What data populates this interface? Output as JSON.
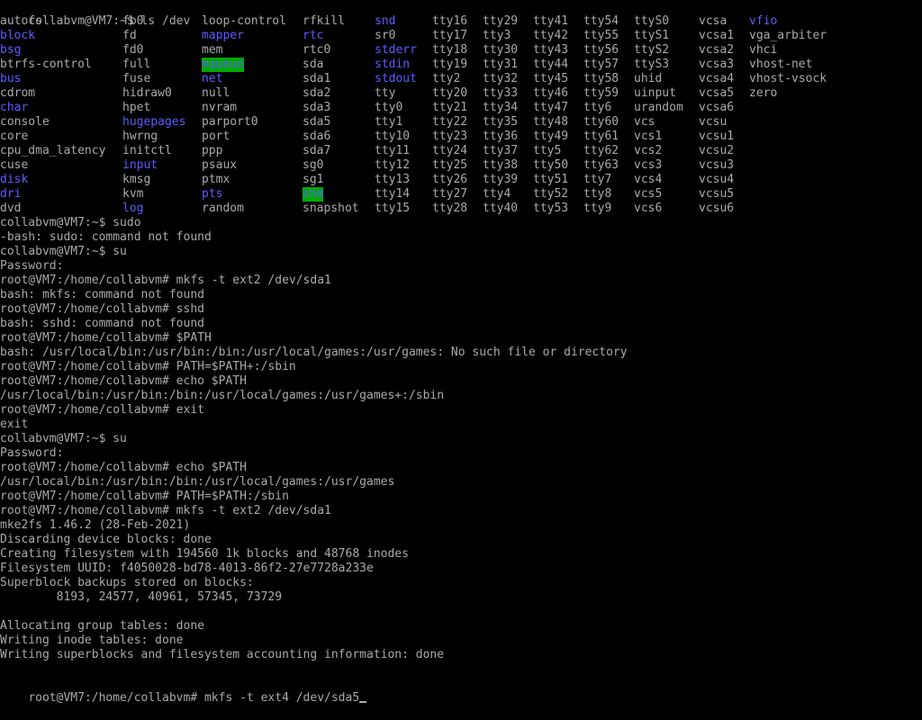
{
  "colors": {
    "background": "#000000",
    "foreground": "#aaaaaa",
    "directory": "#5c5cff",
    "highlight_bg": "#00aa00"
  },
  "first_prompt": "collabvm@VM7:~$ ls /dev",
  "ls_rows": [
    [
      {
        "t": "autofs"
      },
      {
        "t": "fb0"
      },
      {
        "t": "loop-control"
      },
      {
        "t": "rfkill"
      },
      {
        "t": "snd",
        "s": "dir"
      },
      {
        "t": "tty16"
      },
      {
        "t": "tty29"
      },
      {
        "t": "tty41"
      },
      {
        "t": "tty54"
      },
      {
        "t": "ttyS0"
      },
      {
        "t": "vcsa"
      },
      {
        "t": "vfio",
        "s": "dir"
      }
    ],
    [
      {
        "t": "block",
        "s": "dir"
      },
      {
        "t": "fd"
      },
      {
        "t": "mapper",
        "s": "dir"
      },
      {
        "t": "rtc",
        "s": "dir"
      },
      {
        "t": "sr0"
      },
      {
        "t": "tty17"
      },
      {
        "t": "tty3"
      },
      {
        "t": "tty42"
      },
      {
        "t": "tty55"
      },
      {
        "t": "ttyS1"
      },
      {
        "t": "vcsa1"
      },
      {
        "t": "vga_arbiter"
      }
    ],
    [
      {
        "t": "bsg",
        "s": "dir"
      },
      {
        "t": "fd0"
      },
      {
        "t": "mem"
      },
      {
        "t": "rtc0"
      },
      {
        "t": "stderr",
        "s": "dir"
      },
      {
        "t": "tty18"
      },
      {
        "t": "tty30"
      },
      {
        "t": "tty43"
      },
      {
        "t": "tty56"
      },
      {
        "t": "ttyS2"
      },
      {
        "t": "vcsa2"
      },
      {
        "t": "vhci"
      }
    ],
    [
      {
        "t": "btrfs-control"
      },
      {
        "t": "full"
      },
      {
        "t": "mqueue",
        "s": "hl"
      },
      {
        "t": "sda"
      },
      {
        "t": "stdin",
        "s": "dir"
      },
      {
        "t": "tty19"
      },
      {
        "t": "tty31"
      },
      {
        "t": "tty44"
      },
      {
        "t": "tty57"
      },
      {
        "t": "ttyS3"
      },
      {
        "t": "vcsa3"
      },
      {
        "t": "vhost-net"
      }
    ],
    [
      {
        "t": "bus",
        "s": "dir"
      },
      {
        "t": "fuse"
      },
      {
        "t": "net",
        "s": "dir"
      },
      {
        "t": "sda1"
      },
      {
        "t": "stdout",
        "s": "dir"
      },
      {
        "t": "tty2"
      },
      {
        "t": "tty32"
      },
      {
        "t": "tty45"
      },
      {
        "t": "tty58"
      },
      {
        "t": "uhid"
      },
      {
        "t": "vcsa4"
      },
      {
        "t": "vhost-vsock"
      }
    ],
    [
      {
        "t": "cdrom"
      },
      {
        "t": "hidraw0"
      },
      {
        "t": "null"
      },
      {
        "t": "sda2"
      },
      {
        "t": "tty"
      },
      {
        "t": "tty20"
      },
      {
        "t": "tty33"
      },
      {
        "t": "tty46"
      },
      {
        "t": "tty59"
      },
      {
        "t": "uinput"
      },
      {
        "t": "vcsa5"
      },
      {
        "t": "zero"
      }
    ],
    [
      {
        "t": "char",
        "s": "dir"
      },
      {
        "t": "hpet"
      },
      {
        "t": "nvram"
      },
      {
        "t": "sda3"
      },
      {
        "t": "tty0"
      },
      {
        "t": "tty21"
      },
      {
        "t": "tty34"
      },
      {
        "t": "tty47"
      },
      {
        "t": "tty6"
      },
      {
        "t": "urandom"
      },
      {
        "t": "vcsa6"
      },
      {
        "t": ""
      }
    ],
    [
      {
        "t": "console"
      },
      {
        "t": "hugepages",
        "s": "dir"
      },
      {
        "t": "parport0"
      },
      {
        "t": "sda5"
      },
      {
        "t": "tty1"
      },
      {
        "t": "tty22"
      },
      {
        "t": "tty35"
      },
      {
        "t": "tty48"
      },
      {
        "t": "tty60"
      },
      {
        "t": "vcs"
      },
      {
        "t": "vcsu"
      },
      {
        "t": ""
      }
    ],
    [
      {
        "t": "core"
      },
      {
        "t": "hwrng"
      },
      {
        "t": "port"
      },
      {
        "t": "sda6"
      },
      {
        "t": "tty10"
      },
      {
        "t": "tty23"
      },
      {
        "t": "tty36"
      },
      {
        "t": "tty49"
      },
      {
        "t": "tty61"
      },
      {
        "t": "vcs1"
      },
      {
        "t": "vcsu1"
      },
      {
        "t": ""
      }
    ],
    [
      {
        "t": "cpu_dma_latency"
      },
      {
        "t": "initctl"
      },
      {
        "t": "ppp"
      },
      {
        "t": "sda7"
      },
      {
        "t": "tty11"
      },
      {
        "t": "tty24"
      },
      {
        "t": "tty37"
      },
      {
        "t": "tty5"
      },
      {
        "t": "tty62"
      },
      {
        "t": "vcs2"
      },
      {
        "t": "vcsu2"
      },
      {
        "t": ""
      }
    ],
    [
      {
        "t": "cuse"
      },
      {
        "t": "input",
        "s": "dir"
      },
      {
        "t": "psaux"
      },
      {
        "t": "sg0"
      },
      {
        "t": "tty12"
      },
      {
        "t": "tty25"
      },
      {
        "t": "tty38"
      },
      {
        "t": "tty50"
      },
      {
        "t": "tty63"
      },
      {
        "t": "vcs3"
      },
      {
        "t": "vcsu3"
      },
      {
        "t": ""
      }
    ],
    [
      {
        "t": "disk",
        "s": "dir"
      },
      {
        "t": "kmsg"
      },
      {
        "t": "ptmx"
      },
      {
        "t": "sg1"
      },
      {
        "t": "tty13"
      },
      {
        "t": "tty26"
      },
      {
        "t": "tty39"
      },
      {
        "t": "tty51"
      },
      {
        "t": "tty7"
      },
      {
        "t": "vcs4"
      },
      {
        "t": "vcsu4"
      },
      {
        "t": ""
      }
    ],
    [
      {
        "t": "dri",
        "s": "dir"
      },
      {
        "t": "kvm"
      },
      {
        "t": "pts",
        "s": "dir"
      },
      {
        "t": "shm",
        "s": "hl"
      },
      {
        "t": "tty14"
      },
      {
        "t": "tty27"
      },
      {
        "t": "tty4"
      },
      {
        "t": "tty52"
      },
      {
        "t": "tty8"
      },
      {
        "t": "vcs5"
      },
      {
        "t": "vcsu5"
      },
      {
        "t": ""
      }
    ],
    [
      {
        "t": "dvd"
      },
      {
        "t": "log",
        "s": "dir"
      },
      {
        "t": "random"
      },
      {
        "t": "snapshot"
      },
      {
        "t": "tty15"
      },
      {
        "t": "tty28"
      },
      {
        "t": "tty40"
      },
      {
        "t": "tty53"
      },
      {
        "t": "tty9"
      },
      {
        "t": "vcs6"
      },
      {
        "t": "vcsu6"
      },
      {
        "t": ""
      }
    ]
  ],
  "lines": [
    "collabvm@VM7:~$ sudo",
    "-bash: sudo: command not found",
    "collabvm@VM7:~$ su",
    "Password:",
    "root@VM7:/home/collabvm# mkfs -t ext2 /dev/sda1",
    "bash: mkfs: command not found",
    "root@VM7:/home/collabvm# sshd",
    "bash: sshd: command not found",
    "root@VM7:/home/collabvm# $PATH",
    "bash: /usr/local/bin:/usr/bin:/bin:/usr/local/games:/usr/games: No such file or directory",
    "root@VM7:/home/collabvm# PATH=$PATH+:/sbin",
    "root@VM7:/home/collabvm# echo $PATH",
    "/usr/local/bin:/usr/bin:/bin:/usr/local/games:/usr/games+:/sbin",
    "root@VM7:/home/collabvm# exit",
    "exit",
    "collabvm@VM7:~$ su",
    "Password:",
    "root@VM7:/home/collabvm# echo $PATH",
    "/usr/local/bin:/usr/bin:/bin:/usr/local/games:/usr/games",
    "root@VM7:/home/collabvm# PATH=$PATH:/sbin",
    "root@VM7:/home/collabvm# mkfs -t ext2 /dev/sda1",
    "mke2fs 1.46.2 (28-Feb-2021)",
    "Discarding device blocks: done",
    "Creating filesystem with 194560 1k blocks and 48768 inodes",
    "Filesystem UUID: f4050028-bd78-4013-86f2-27e7728a233e",
    "Superblock backups stored on blocks:",
    "        8193, 24577, 40961, 57345, 73729",
    "",
    "Allocating group tables: done",
    "Writing inode tables: done",
    "Writing superblocks and filesystem accounting information: done",
    ""
  ],
  "current_prompt": "root@VM7:/home/collabvm# mkfs -t ext4 /dev/sda5"
}
